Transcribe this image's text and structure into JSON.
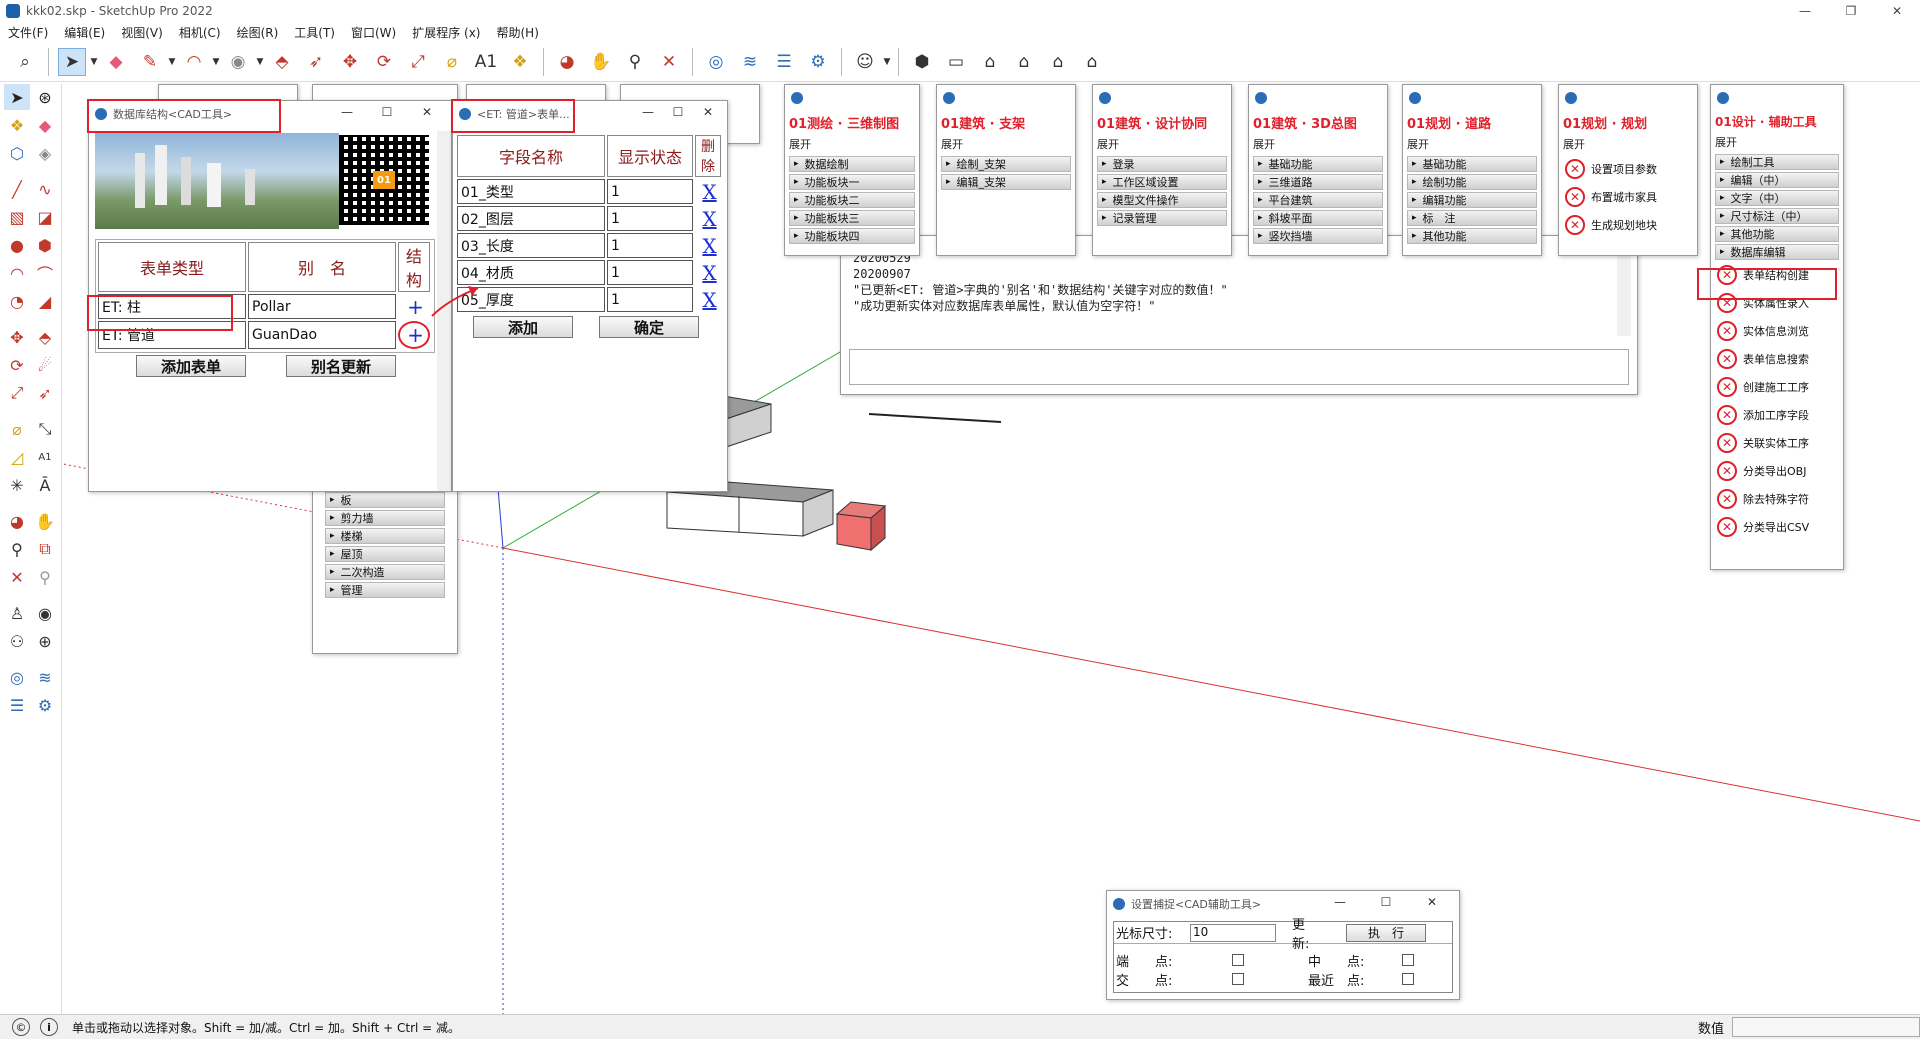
{
  "window": {
    "title": "kkk02.skp - SketchUp Pro 2022",
    "minimize": "—",
    "restore": "❐",
    "close": "✕"
  },
  "menubar": [
    "文件(F)",
    "编辑(E)",
    "视图(V)",
    "相机(C)",
    "绘图(R)",
    "工具(T)",
    "窗口(W)",
    "扩展程序 (x)",
    "帮助(H)"
  ],
  "db_window": {
    "title": "数据库结构<CAD工具>",
    "headers": [
      "表单类型",
      "别　名",
      "结构"
    ],
    "rows": [
      {
        "type": "ET: 柱",
        "alias": "Pollar",
        "action": "+"
      },
      {
        "type": "ET: 管道",
        "alias": "GuanDao",
        "action": "+"
      }
    ],
    "add_form_label": "添加表单",
    "alias_update_label": "别名更新"
  },
  "form_window": {
    "title": "<ET: 管道>表单...",
    "headers": [
      "字段名称",
      "显示状态",
      "删除"
    ],
    "rows": [
      {
        "name": "01_类型",
        "state": "1",
        "del": "X"
      },
      {
        "name": "02_图层",
        "state": "1",
        "del": "X"
      },
      {
        "name": "03_长度",
        "state": "1",
        "del": "X"
      },
      {
        "name": "04_材质",
        "state": "1",
        "del": "X"
      },
      {
        "name": "05_厚度",
        "state": "1",
        "del": "X"
      }
    ],
    "add_label": "添加",
    "ok_label": "确定"
  },
  "bg_menu_items": [
    "板",
    "剪力墙",
    "楼梯",
    "屋顶",
    "二次构造",
    "管理"
  ],
  "panels": [
    {
      "title": "01测绘 · 三维制图",
      "expand": "展开",
      "items": [
        "数据绘制",
        "功能板块一",
        "功能板块二",
        "功能板块三",
        "功能板块四"
      ]
    },
    {
      "title": "01建筑 · 支架",
      "expand": "展开",
      "items": [
        "绘制_支架",
        "编辑_支架"
      ]
    },
    {
      "title": "01建筑 · 设计协同",
      "expand": "展开",
      "items": [
        "登录",
        "工作区域设置",
        "模型文件操作",
        "记录管理"
      ]
    },
    {
      "title": "01建筑 · 3D总图",
      "expand": "展开",
      "items": [
        "基础功能",
        "三维道路",
        "平台建筑",
        "斜坡平面",
        "竖坎挡墙"
      ]
    },
    {
      "title": "01规划 · 道路",
      "expand": "展开",
      "items": [
        "基础功能",
        "绘制功能",
        "编辑功能",
        "标　注",
        "其他功能"
      ]
    },
    {
      "title": "01规划 · 规划",
      "expand": "展开",
      "items": [
        "设置项目参数",
        "布置城市家具",
        "生成规划地块"
      ]
    }
  ],
  "design_panel": {
    "title": "01设计 · 辅助工具",
    "expand": "展开",
    "groups": [
      "绘制工具",
      "编辑（中）",
      "文字（中）",
      "尺寸标注（中）",
      "其他功能",
      "数据库编辑"
    ],
    "items": [
      "表单结构创建",
      "实体属性录入",
      "实体信息浏览",
      "表单信息搜索",
      "创建施工工序",
      "添加工序字段",
      "关联实体工序",
      "分类导出OBJ",
      "除去特殊字符",
      "分类导出CSV"
    ]
  },
  "console": {
    "lines": [
      "20200529",
      "20200907",
      "\"已更新<ET: 管道>字典的'别名'和'数据结构'关键字对应的数值！\"",
      "\"成功更新实体对应数据库表单属性，默认值为空字符！\""
    ]
  },
  "snap_window": {
    "title": "设置捕捉<CAD辅助工具>",
    "cursor_label": "光标尺寸:",
    "cursor_value": "10",
    "update_label": "更　　新:",
    "exec_label": "执　行",
    "opts": [
      "端　　点:",
      "中　　点:",
      "交　　点:",
      "最近　点:"
    ]
  },
  "status": {
    "hint": "单击或拖动以选择对象。Shift = 加/减。Ctrl = 加。Shift + Ctrl = 减。",
    "value_label": "数值"
  },
  "colors": {
    "accent_red": "#e0202a",
    "header_text": "#8b1a1a",
    "link_blue": "#1a2fd6"
  }
}
